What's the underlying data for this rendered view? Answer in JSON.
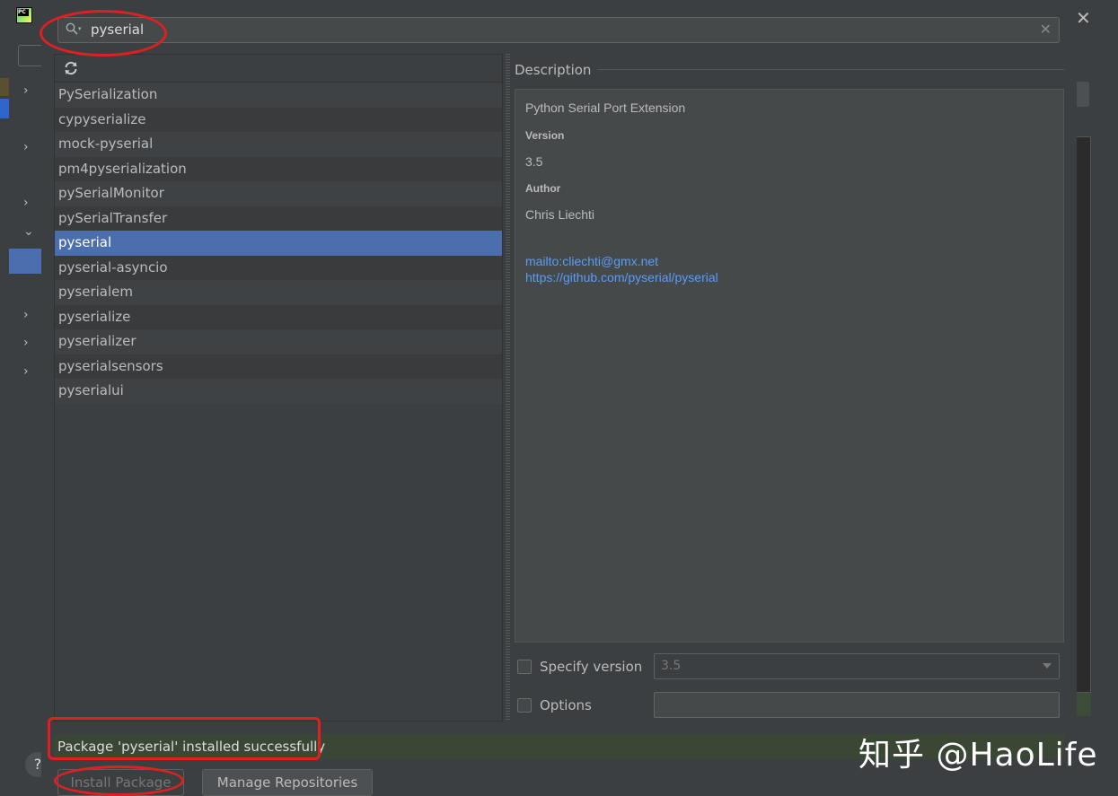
{
  "search": {
    "value": "pyserial"
  },
  "packages": [
    "PySerialization",
    "cypyserialize",
    "mock-pyserial",
    "pm4pyserialization",
    "pySerialMonitor",
    "pySerialTransfer",
    "pyserial",
    "pyserial-asyncio",
    "pyserialem",
    "pyserialize",
    "pyserializer",
    "pyserialsensors",
    "pyserialui"
  ],
  "selected_package": "pyserial",
  "description": {
    "title": "Description",
    "summary": "Python Serial Port Extension",
    "version_label": "Version",
    "version": "3.5",
    "author_label": "Author",
    "author": "Chris Liechti",
    "email_link": "mailto:cliechti@gmx.net",
    "url_link": "https://github.com/pyserial/pyserial"
  },
  "options": {
    "specify_version_label": "Specify version",
    "specify_version_value": "3.5",
    "options_label": "Options",
    "options_value": ""
  },
  "status": {
    "message": "Package 'pyserial' installed successfully"
  },
  "buttons": {
    "install": "Install Package",
    "manage": "Manage Repositories"
  },
  "watermark": "知乎 @HaoLife",
  "colors": {
    "selection": "#4b6eaf",
    "link": "#589df6",
    "annotation": "#e02020",
    "status_bg": "#3a4734"
  }
}
